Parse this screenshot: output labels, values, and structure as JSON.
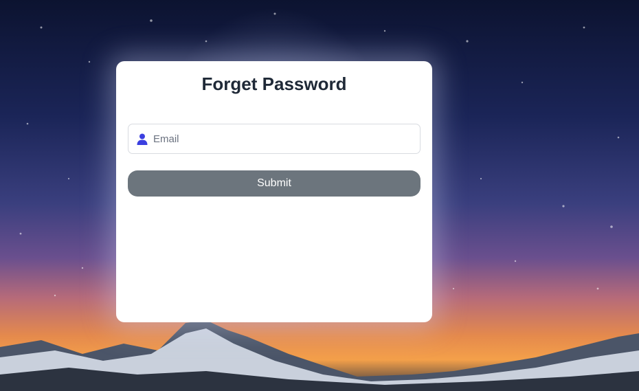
{
  "form": {
    "title": "Forget Password",
    "email_placeholder": "Email",
    "submit_label": "Submit"
  },
  "colors": {
    "icon_accent": "#3b3fe0",
    "button_bg": "#6c757d",
    "card_bg": "#ffffff",
    "title_text": "#1f2937"
  }
}
